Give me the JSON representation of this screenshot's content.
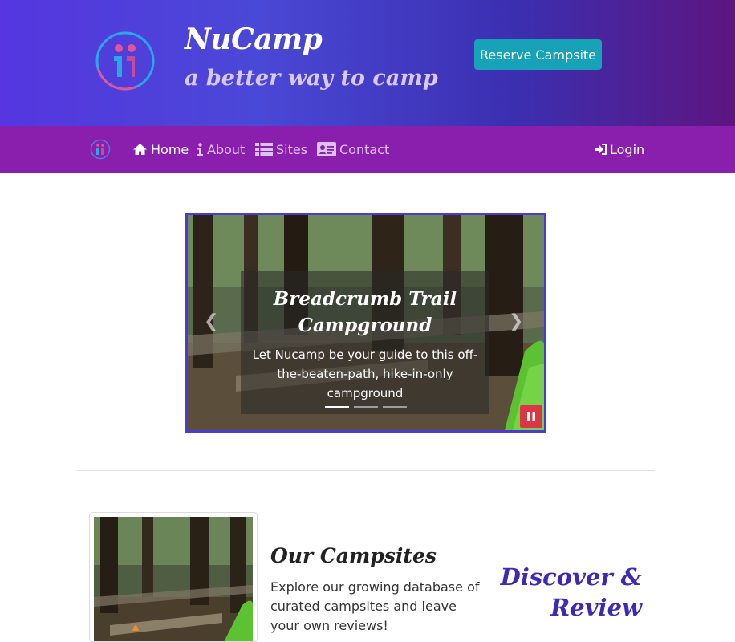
{
  "header": {
    "brand": "NuCamp",
    "tagline": "a better way to camp",
    "reserve_label": "Reserve Campsite"
  },
  "navbar": {
    "items": [
      {
        "label": "Home",
        "icon": "home-icon",
        "active": true
      },
      {
        "label": "About",
        "icon": "info-icon",
        "active": false
      },
      {
        "label": "Sites",
        "icon": "list-icon",
        "active": false
      },
      {
        "label": "Contact",
        "icon": "address-card-icon",
        "active": false
      }
    ],
    "login_label": "Login",
    "login_icon": "sign-in-icon"
  },
  "carousel": {
    "slide_title": "Breadcrumb Trail Campground",
    "slide_text": "Let Nucamp be your guide to this off-the-beaten-path, hike-in-only campground",
    "indicator_count": 3,
    "active_index": 0,
    "pause_icon": "pause-icon"
  },
  "feature": {
    "title": "Our Campsites",
    "text": "Explore our growing database of curated campsites and leave your own reviews!",
    "side_heading": "Discover & Review"
  },
  "colors": {
    "header_gradient_start": "#5536e0",
    "header_gradient_end": "#5e1580",
    "navbar": "#8b1fad",
    "reserve_button": "#17a2b8",
    "pause_button": "#dc3545",
    "accent_heading": "#3b2ab5"
  }
}
